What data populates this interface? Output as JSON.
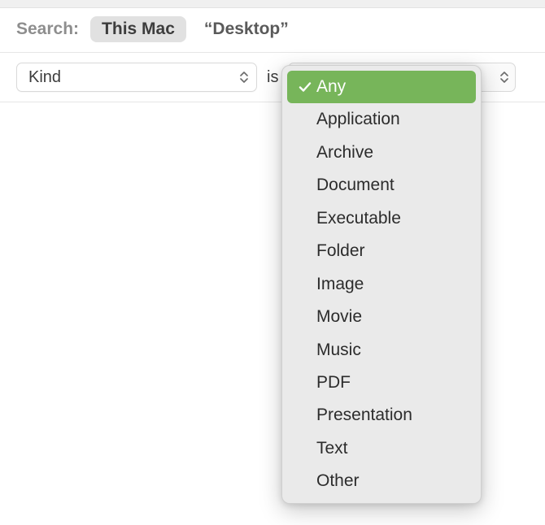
{
  "search": {
    "label": "Search:",
    "scopes": [
      {
        "label": "This Mac",
        "active": true
      },
      {
        "label": "“Desktop”",
        "active": false
      }
    ]
  },
  "criteria": {
    "attribute_selected": "Kind",
    "operator_text": "is",
    "value_selected": "Any"
  },
  "kind_dropdown": {
    "selected_index": 0,
    "options": [
      "Any",
      "Application",
      "Archive",
      "Document",
      "Executable",
      "Folder",
      "Image",
      "Movie",
      "Music",
      "PDF",
      "Presentation",
      "Text",
      "Other"
    ]
  }
}
